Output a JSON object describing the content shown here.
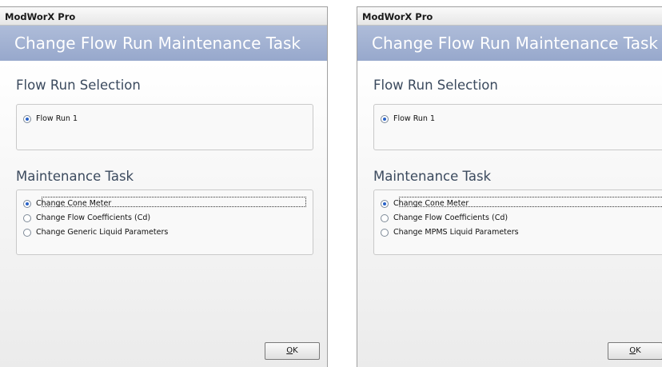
{
  "left": {
    "app_title": "ModWorX Pro",
    "banner_title": "Change Flow Run Maintenance Task",
    "flow_section_title": "Flow Run Selection",
    "flow_runs": [
      {
        "label": "Flow Run 1",
        "selected": true
      }
    ],
    "task_section_title": "Maintenance Task",
    "tasks": [
      {
        "label": "Change Cone Meter",
        "selected": true,
        "focused": true
      },
      {
        "label": "Change Flow Coefficients (Cd)",
        "selected": false
      },
      {
        "label": "Change Generic Liquid Parameters",
        "selected": false
      }
    ],
    "ok_mnemonic": "O",
    "ok_rest": "K"
  },
  "right": {
    "app_title": "ModWorX Pro",
    "banner_title": "Change Flow Run Maintenance Task",
    "flow_section_title": "Flow Run Selection",
    "flow_runs": [
      {
        "label": "Flow Run 1",
        "selected": true
      }
    ],
    "task_section_title": "Maintenance Task",
    "tasks": [
      {
        "label": "Change Cone Meter",
        "selected": true,
        "focused": true
      },
      {
        "label": "Change Flow Coefficients (Cd)",
        "selected": false
      },
      {
        "label": "Change MPMS Liquid Parameters",
        "selected": false
      }
    ],
    "ok_mnemonic": "O",
    "ok_rest": "K"
  },
  "colors": {
    "banner_bg": "#9dadd0",
    "section_title": "#3b4a5e",
    "radio_dot": "#2a63c8"
  }
}
